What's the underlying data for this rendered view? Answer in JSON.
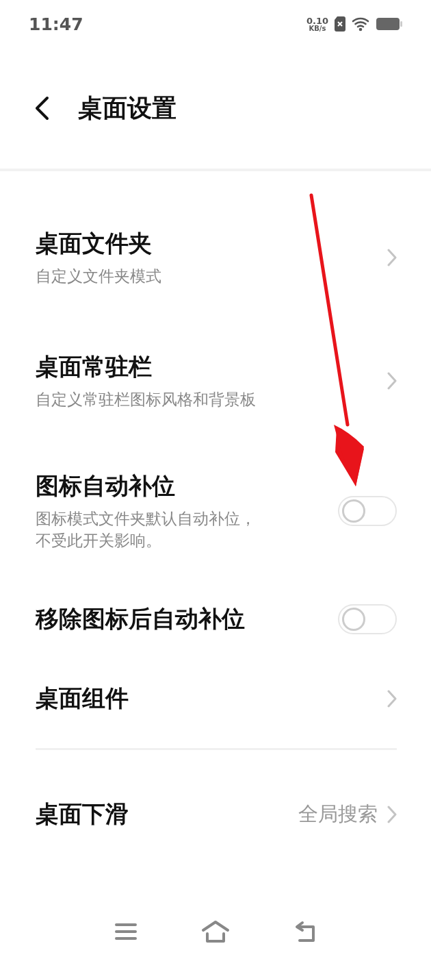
{
  "status_bar": {
    "time": "11:47",
    "speed": "0.10",
    "speed_unit": "KB/s"
  },
  "header": {
    "title": "桌面设置"
  },
  "groups": [
    {
      "items": [
        {
          "kind": "link",
          "title": "桌面文件夹",
          "subtitle": "自定义文件夹模式"
        },
        {
          "kind": "link",
          "title": "桌面常驻栏",
          "subtitle": "自定义常驻栏图标风格和背景板"
        },
        {
          "kind": "toggle",
          "title": "图标自动补位",
          "subtitle_lines": [
            "图标模式文件夹默认自动补位，",
            "不受此开关影响。"
          ],
          "on": false
        },
        {
          "kind": "toggle",
          "title": "移除图标后自动补位",
          "on": false
        },
        {
          "kind": "link",
          "title": "桌面组件"
        }
      ]
    },
    {
      "items": [
        {
          "kind": "value",
          "title": "桌面下滑",
          "value": "全局搜索"
        }
      ]
    }
  ]
}
